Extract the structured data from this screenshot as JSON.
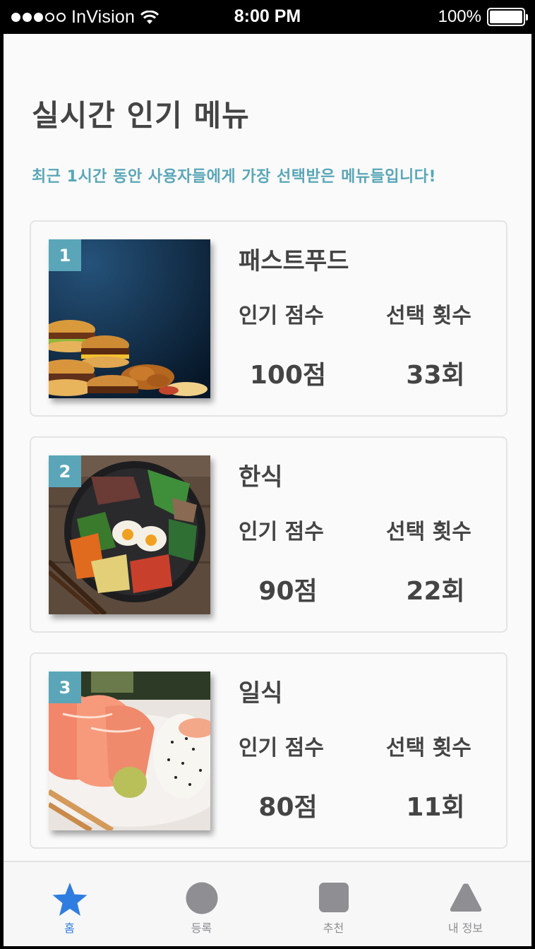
{
  "status_bar": {
    "carrier": "InVision",
    "time": "8:00 PM",
    "battery": "100%"
  },
  "page": {
    "title": "실시간 인기 메뉴",
    "subtitle": "최근 1시간 동안 사용자들에게 가장 선택받은 메뉴들입니다!"
  },
  "menus": [
    {
      "rank": "1",
      "name": "패스트푸드",
      "score_label": "인기 점수",
      "count_label": "선택 횟수",
      "score": "100점",
      "count": "33회"
    },
    {
      "rank": "2",
      "name": "한식",
      "score_label": "인기 점수",
      "count_label": "선택 횟수",
      "score": "90점",
      "count": "22회"
    },
    {
      "rank": "3",
      "name": "일식",
      "score_label": "인기 점수",
      "count_label": "선택 횟수",
      "score": "80점",
      "count": "11회"
    }
  ],
  "tabs": [
    {
      "label": "홈",
      "icon": "star-icon",
      "active": true
    },
    {
      "label": "등록",
      "icon": "circle-icon",
      "active": false
    },
    {
      "label": "추천",
      "icon": "square-icon",
      "active": false
    },
    {
      "label": "내 정보",
      "icon": "triangle-icon",
      "active": false
    }
  ],
  "colors": {
    "accent": "#5aa6b8",
    "tab_active": "#2f7de1",
    "tab_inactive": "#8e8e93",
    "text": "#444444"
  }
}
